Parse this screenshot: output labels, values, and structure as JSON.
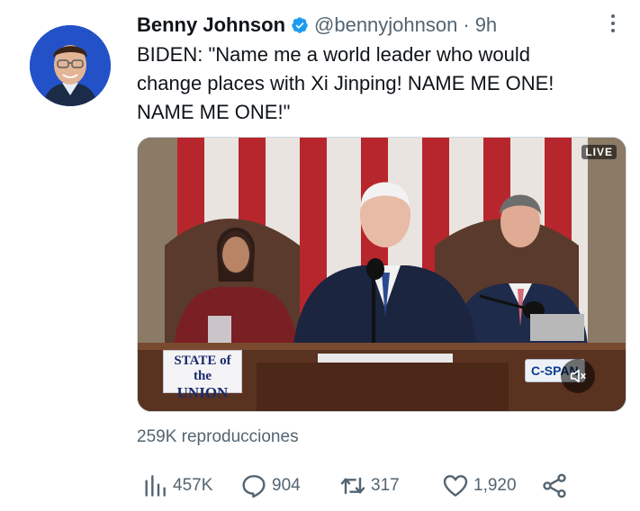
{
  "author": {
    "display_name": "Benny Johnson",
    "handle": "@bennyjohnson",
    "separator": "·",
    "time": "9h",
    "verified": true,
    "verified_color": "#1d9bf0"
  },
  "tweet": {
    "text": "BIDEN: \"Name me a world leader who would\nchange places with Xi Jinping! NAME ME ONE!\nNAME ME ONE!\""
  },
  "media": {
    "live_label": "LIVE",
    "logo_line1": "STATE of the",
    "logo_line2": "UNION",
    "network_label": "C-SPAN"
  },
  "views_text": "259K reproducciones",
  "actions": {
    "views": "457K",
    "replies": "904",
    "retweets": "317",
    "likes": "1,920"
  },
  "icons": {
    "more": "more-vertical-icon",
    "views": "bar-chart-icon",
    "reply": "speech-bubble-icon",
    "retweet": "retweet-arrows-icon",
    "like": "heart-icon",
    "share": "share-nodes-icon",
    "mute": "speaker-muted-icon"
  },
  "colors": {
    "text": "#0f1419",
    "secondary": "#536471",
    "accent": "#1d9bf0"
  }
}
